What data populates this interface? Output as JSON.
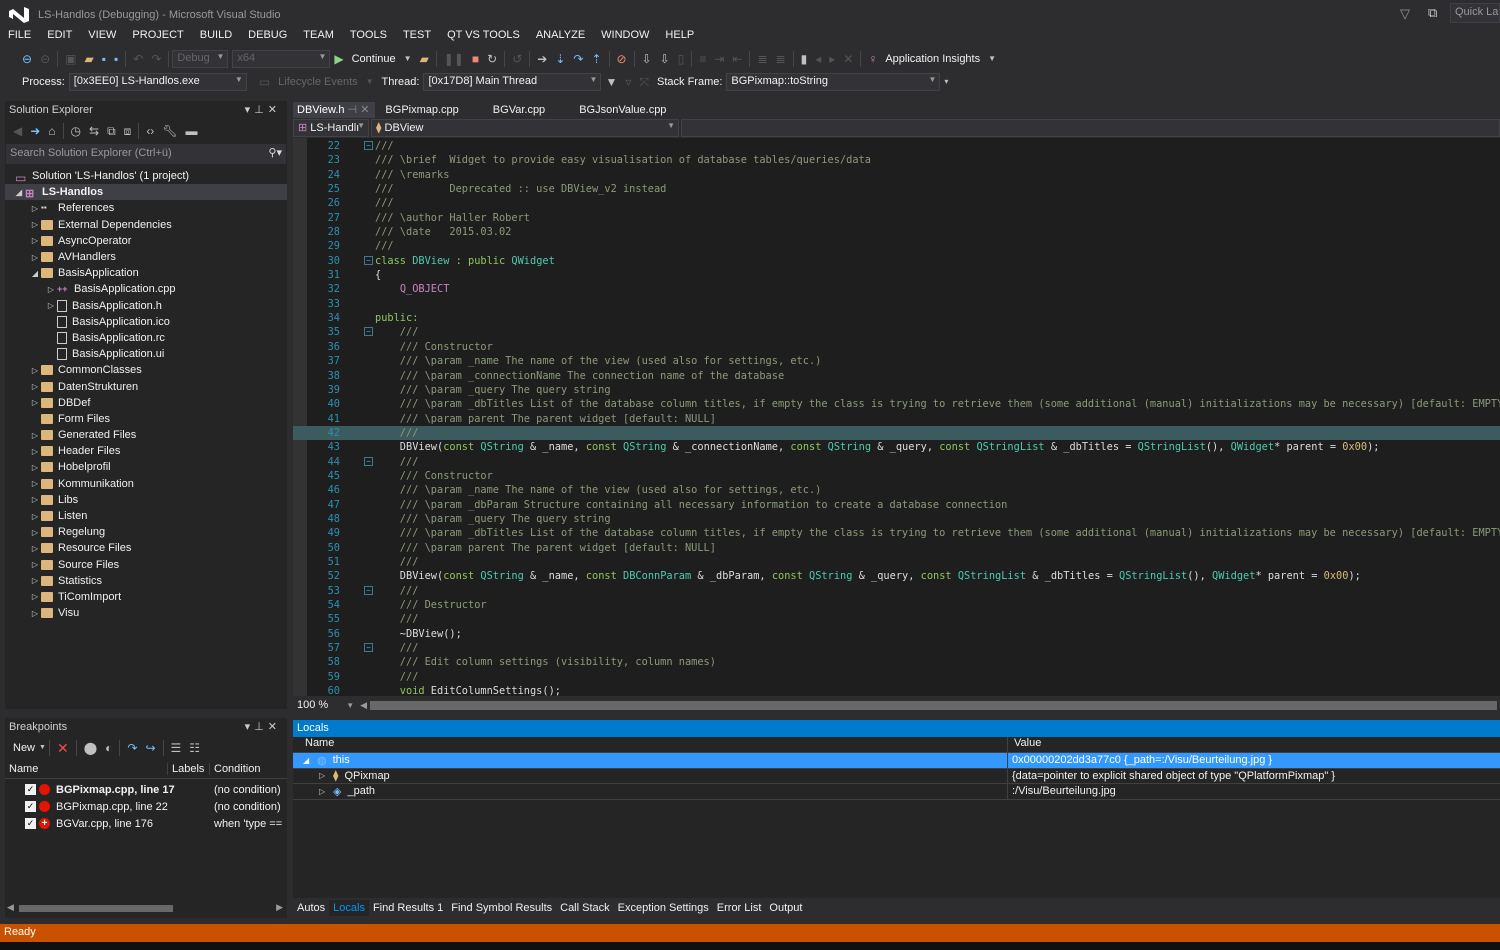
{
  "window": {
    "title": "LS-Handlos (Debugging) - Microsoft Visual Studio",
    "quick_launch_placeholder": "Quick Launch"
  },
  "menu": [
    "FILE",
    "EDIT",
    "VIEW",
    "PROJECT",
    "BUILD",
    "DEBUG",
    "TEAM",
    "TOOLS",
    "TEST",
    "QT VS TOOLS",
    "ANALYZE",
    "WINDOW",
    "HELP"
  ],
  "toolbar": {
    "config": "Debug",
    "platform": "x64",
    "continue_label": "Continue",
    "app_insights_label": "Application Insights",
    "process_label": "Process:",
    "process_value": "[0x3EE0] LS-Handlos.exe",
    "lifecycle_label": "Lifecycle Events",
    "thread_label": "Thread:",
    "thread_value": "[0x17D8] Main Thread",
    "stack_frame_label": "Stack Frame:",
    "stack_frame_value": "BGPixmap::toString"
  },
  "solution_explorer": {
    "title": "Solution Explorer",
    "search_placeholder": "Search Solution Explorer (Ctrl+ü)",
    "items": [
      {
        "label": "Solution 'LS-Handlos' (1 project)",
        "depth": 0,
        "expander": "",
        "icon": "solution"
      },
      {
        "label": "LS-Handlos",
        "depth": 0,
        "expander": "open",
        "icon": "project",
        "selected": true,
        "bold": true
      },
      {
        "label": "References",
        "depth": 1,
        "expander": "closed",
        "icon": "references"
      },
      {
        "label": "External Dependencies",
        "depth": 1,
        "expander": "closed",
        "icon": "folder"
      },
      {
        "label": "AsyncOperator",
        "depth": 1,
        "expander": "closed",
        "icon": "folder"
      },
      {
        "label": "AVHandlers",
        "depth": 1,
        "expander": "closed",
        "icon": "folder"
      },
      {
        "label": "BasisApplication",
        "depth": 1,
        "expander": "open",
        "icon": "folder"
      },
      {
        "label": "BasisApplication.cpp",
        "depth": 2,
        "expander": "closed",
        "icon": "cpp"
      },
      {
        "label": "BasisApplication.h",
        "depth": 2,
        "expander": "closed",
        "icon": "file"
      },
      {
        "label": "BasisApplication.ico",
        "depth": 2,
        "expander": "",
        "icon": "file"
      },
      {
        "label": "BasisApplication.rc",
        "depth": 2,
        "expander": "",
        "icon": "file"
      },
      {
        "label": "BasisApplication.ui",
        "depth": 2,
        "expander": "",
        "icon": "file"
      },
      {
        "label": "CommonClasses",
        "depth": 1,
        "expander": "closed",
        "icon": "folder"
      },
      {
        "label": "DatenStrukturen",
        "depth": 1,
        "expander": "closed",
        "icon": "folder"
      },
      {
        "label": "DBDef",
        "depth": 1,
        "expander": "closed",
        "icon": "folder"
      },
      {
        "label": "Form Files",
        "depth": 1,
        "expander": "",
        "icon": "folder"
      },
      {
        "label": "Generated Files",
        "depth": 1,
        "expander": "closed",
        "icon": "folder"
      },
      {
        "label": "Header Files",
        "depth": 1,
        "expander": "closed",
        "icon": "folder"
      },
      {
        "label": "Hobelprofil",
        "depth": 1,
        "expander": "closed",
        "icon": "folder"
      },
      {
        "label": "Kommunikation",
        "depth": 1,
        "expander": "closed",
        "icon": "folder"
      },
      {
        "label": "Libs",
        "depth": 1,
        "expander": "closed",
        "icon": "folder"
      },
      {
        "label": "Listen",
        "depth": 1,
        "expander": "closed",
        "icon": "folder"
      },
      {
        "label": "Regelung",
        "depth": 1,
        "expander": "closed",
        "icon": "folder"
      },
      {
        "label": "Resource Files",
        "depth": 1,
        "expander": "closed",
        "icon": "folder"
      },
      {
        "label": "Source Files",
        "depth": 1,
        "expander": "closed",
        "icon": "folder"
      },
      {
        "label": "Statistics",
        "depth": 1,
        "expander": "closed",
        "icon": "folder"
      },
      {
        "label": "TiComImport",
        "depth": 1,
        "expander": "closed",
        "icon": "folder"
      },
      {
        "label": "Visu",
        "depth": 1,
        "expander": "closed",
        "icon": "folder"
      }
    ]
  },
  "breakpoints": {
    "title": "Breakpoints",
    "new_label": "New",
    "columns": [
      "Name",
      "Labels",
      "Condition"
    ],
    "rows": [
      {
        "name": "BGPixmap.cpp, line 17",
        "labels": "",
        "condition": "(no condition)",
        "checked": true,
        "bold": true,
        "conditional": false
      },
      {
        "name": "BGPixmap.cpp, line 22",
        "labels": "",
        "condition": "(no condition)",
        "checked": true,
        "bold": false,
        "conditional": false
      },
      {
        "name": "BGVar.cpp, line 176",
        "labels": "",
        "condition": "when 'type ==",
        "checked": true,
        "bold": false,
        "conditional": true
      }
    ]
  },
  "editor": {
    "tabs": [
      {
        "label": "DBView.h",
        "active": true
      },
      {
        "label": "BGPixmap.cpp",
        "active": false
      },
      {
        "label": "BGVar.cpp",
        "active": false
      },
      {
        "label": "BGJsonValue.cpp",
        "active": false
      }
    ],
    "project_combo": "LS-Handlı",
    "scope_combo": "DBView",
    "zoom": "100 %",
    "highlighted_line": 42,
    "lines": [
      {
        "n": 22,
        "fold": true,
        "t": [
          [
            "c-com",
            "///"
          ]
        ]
      },
      {
        "n": 23,
        "t": [
          [
            "c-com",
            "/// \\brief  Widget to provide easy visualisation of database tables/queries/data"
          ]
        ]
      },
      {
        "n": 24,
        "t": [
          [
            "c-com",
            "/// \\remarks"
          ]
        ]
      },
      {
        "n": 25,
        "t": [
          [
            "c-com",
            "///         Deprecated :: use DBView_v2 instead"
          ]
        ]
      },
      {
        "n": 26,
        "t": [
          [
            "c-com",
            "///"
          ]
        ]
      },
      {
        "n": 27,
        "t": [
          [
            "c-com",
            "/// \\author Haller Robert"
          ]
        ]
      },
      {
        "n": 28,
        "t": [
          [
            "c-com",
            "/// \\date   2015.03.02"
          ]
        ]
      },
      {
        "n": 29,
        "t": [
          [
            "c-com",
            "///"
          ]
        ]
      },
      {
        "n": 30,
        "fold": true,
        "t": [
          [
            "c-kw",
            "class "
          ],
          [
            "c-type",
            "DBView"
          ],
          [
            "c-kw",
            " : public "
          ],
          [
            "c-type",
            "QWidget"
          ]
        ]
      },
      {
        "n": 31,
        "t": [
          [
            "",
            "{"
          ]
        ]
      },
      {
        "n": 32,
        "t": [
          [
            "",
            "    "
          ],
          [
            "c-mac",
            "Q_OBJECT"
          ]
        ]
      },
      {
        "n": 33,
        "t": [
          [
            "",
            ""
          ]
        ]
      },
      {
        "n": 34,
        "t": [
          [
            "c-kw",
            "public:"
          ]
        ]
      },
      {
        "n": 35,
        "fold": true,
        "t": [
          [
            "c-com",
            "    ///"
          ]
        ]
      },
      {
        "n": 36,
        "t": [
          [
            "c-com",
            "    /// Constructor"
          ]
        ]
      },
      {
        "n": 37,
        "t": [
          [
            "c-com",
            "    /// \\param _name The name of the view (used also for settings, etc.)"
          ]
        ]
      },
      {
        "n": 38,
        "t": [
          [
            "c-com",
            "    /// \\param _connectionName The connection name of the database"
          ]
        ]
      },
      {
        "n": 39,
        "t": [
          [
            "c-com",
            "    /// \\param _query The query string"
          ]
        ]
      },
      {
        "n": 40,
        "t": [
          [
            "c-com",
            "    /// \\param _dbTitles List of the database column titles, if empty the class is trying to retrieve them (some additional (manual) initializations may be necessary) [default: EMPTY]"
          ]
        ]
      },
      {
        "n": 41,
        "t": [
          [
            "c-com",
            "    /// \\param parent The parent widget [default: NULL]"
          ]
        ]
      },
      {
        "n": 42,
        "t": [
          [
            "c-com",
            "    ///"
          ]
        ]
      },
      {
        "n": 43,
        "t": [
          [
            "",
            "    DBView("
          ],
          [
            "c-kw",
            "const "
          ],
          [
            "c-type",
            "QString"
          ],
          [
            "",
            " & _name, "
          ],
          [
            "c-kw",
            "const "
          ],
          [
            "c-type",
            "QString"
          ],
          [
            "",
            " & _connectionName, "
          ],
          [
            "c-kw",
            "const "
          ],
          [
            "c-type",
            "QString"
          ],
          [
            "",
            " & _query, "
          ],
          [
            "c-kw",
            "const "
          ],
          [
            "c-type",
            "QStringList"
          ],
          [
            "",
            " & _dbTitles = "
          ],
          [
            "c-type",
            "QStringList"
          ],
          [
            "",
            "(), "
          ],
          [
            "c-type",
            "QWidget"
          ],
          [
            "",
            "* parent = "
          ],
          [
            "c-num",
            "0x00"
          ],
          [
            "",
            ");"
          ]
        ]
      },
      {
        "n": 44,
        "fold": true,
        "t": [
          [
            "c-com",
            "    ///"
          ]
        ]
      },
      {
        "n": 45,
        "t": [
          [
            "c-com",
            "    /// Constructor"
          ]
        ]
      },
      {
        "n": 46,
        "t": [
          [
            "c-com",
            "    /// \\param _name The name of the view (used also for settings, etc.)"
          ]
        ]
      },
      {
        "n": 47,
        "t": [
          [
            "c-com",
            "    /// \\param _dbParam Structure containing all necessary information to create a database connection"
          ]
        ]
      },
      {
        "n": 48,
        "t": [
          [
            "c-com",
            "    /// \\param _query The query string"
          ]
        ]
      },
      {
        "n": 49,
        "t": [
          [
            "c-com",
            "    /// \\param _dbTitles List of the database column titles, if empty the class is trying to retrieve them (some additional (manual) initializations may be necessary) [default: EMPTY]"
          ]
        ]
      },
      {
        "n": 50,
        "t": [
          [
            "c-com",
            "    /// \\param parent The parent widget [default: NULL]"
          ]
        ]
      },
      {
        "n": 51,
        "t": [
          [
            "c-com",
            "    ///"
          ]
        ]
      },
      {
        "n": 52,
        "t": [
          [
            "",
            "    DBView("
          ],
          [
            "c-kw",
            "const "
          ],
          [
            "c-type",
            "QString"
          ],
          [
            "",
            " & _name, "
          ],
          [
            "c-kw",
            "const "
          ],
          [
            "c-type",
            "DBConnParam"
          ],
          [
            "",
            " & _dbParam, "
          ],
          [
            "c-kw",
            "const "
          ],
          [
            "c-type",
            "QString"
          ],
          [
            "",
            " & _query, "
          ],
          [
            "c-kw",
            "const "
          ],
          [
            "c-type",
            "QStringList"
          ],
          [
            "",
            " & _dbTitles = "
          ],
          [
            "c-type",
            "QStringList"
          ],
          [
            "",
            "(), "
          ],
          [
            "c-type",
            "QWidget"
          ],
          [
            "",
            "* parent = "
          ],
          [
            "c-num",
            "0x00"
          ],
          [
            "",
            ");"
          ]
        ]
      },
      {
        "n": 53,
        "fold": true,
        "t": [
          [
            "c-com",
            "    ///"
          ]
        ]
      },
      {
        "n": 54,
        "t": [
          [
            "c-com",
            "    /// Destructor"
          ]
        ]
      },
      {
        "n": 55,
        "t": [
          [
            "c-com",
            "    ///"
          ]
        ]
      },
      {
        "n": 56,
        "t": [
          [
            "",
            "    ~DBView();"
          ]
        ]
      },
      {
        "n": 57,
        "fold": true,
        "t": [
          [
            "c-com",
            "    ///"
          ]
        ]
      },
      {
        "n": 58,
        "t": [
          [
            "c-com",
            "    /// Edit column settings (visibility, column names)"
          ]
        ]
      },
      {
        "n": 59,
        "t": [
          [
            "c-com",
            "    ///"
          ]
        ]
      },
      {
        "n": 60,
        "t": [
          [
            "c-kw",
            "    void "
          ],
          [
            "",
            "EditColumnSettings();"
          ]
        ]
      }
    ]
  },
  "locals": {
    "title": "Locals",
    "columns": [
      "Name",
      "Value"
    ],
    "rows": [
      {
        "name": "this",
        "value": "0x00000202dd3a77c0 {_path=:/Visu/Beurteilung.jpg }",
        "expander": "open",
        "selected": true,
        "depth": 0
      },
      {
        "name": "QPixmap",
        "value": "{data=pointer to explicit shared object of type \"QPlatformPixmap\" }",
        "expander": "closed",
        "selected": false,
        "depth": 1
      },
      {
        "name": "_path",
        "value": ":/Visu/Beurteilung.jpg",
        "expander": "closed",
        "selected": false,
        "depth": 1
      }
    ]
  },
  "bottom_tabs": [
    {
      "label": "Autos",
      "active": false
    },
    {
      "label": "Locals",
      "active": true
    },
    {
      "label": "Find Results 1",
      "active": false
    },
    {
      "label": "Find Symbol Results",
      "active": false
    },
    {
      "label": "Call Stack",
      "active": false
    },
    {
      "label": "Exception Settings",
      "active": false
    },
    {
      "label": "Error List",
      "active": false
    },
    {
      "label": "Output",
      "active": false
    }
  ],
  "status": {
    "text": "Ready"
  },
  "colors": {
    "accent": "#007acc",
    "status_bar": "#ca5100",
    "selection": "#3399ff",
    "breakpoint": "#e51400"
  }
}
